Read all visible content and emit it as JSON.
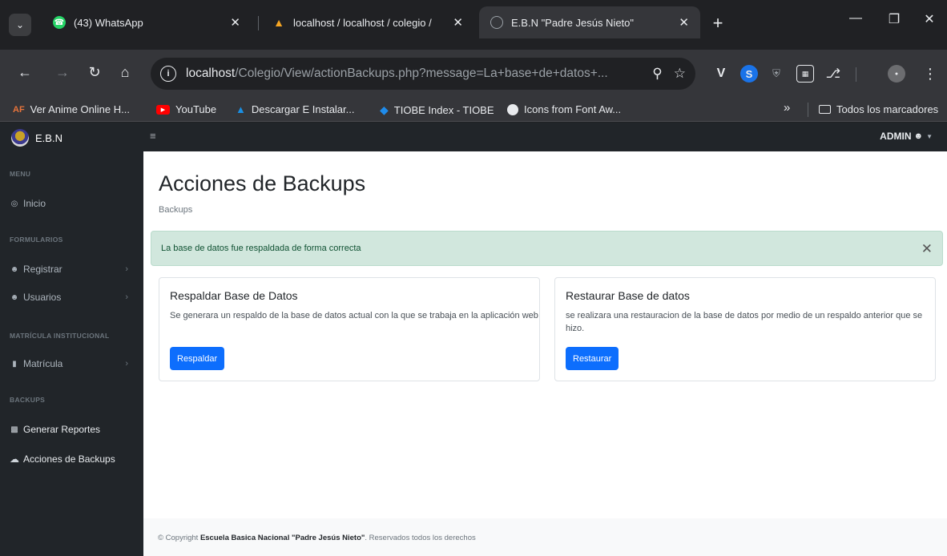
{
  "browser": {
    "tabs": [
      {
        "title": "(43) WhatsApp",
        "icon": "whatsapp-icon",
        "color": "#25d366"
      },
      {
        "title": "localhost / localhost / colegio / ",
        "icon": "phpmyadmin-icon",
        "color": "#f6a623"
      },
      {
        "title": "E.B.N \"Padre Jesús Nieto\"",
        "icon": "globe-icon",
        "color": "#9aa0a6"
      }
    ],
    "address": {
      "host": "localhost",
      "path": "/Colegio/View/actionBackups.php?message=La+base+de+datos+..."
    },
    "bookmarks": [
      {
        "label": "Ver Anime Online H...",
        "icon": "af-icon",
        "color": "#e8743b"
      },
      {
        "label": "YouTube",
        "icon": "youtube-icon",
        "color": "#ff0000"
      },
      {
        "label": "Descargar E Instalar...",
        "icon": "download-icon",
        "color": "#1a8fe3"
      },
      {
        "label": "TIOBE Index - TIOBE",
        "icon": "tiobe-icon",
        "color": "#1f8ceb"
      },
      {
        "label": "Icons from Font Aw...",
        "icon": "globe-icon",
        "color": "#e8eaed"
      }
    ],
    "bookmarks_overflow": "»",
    "all_bookmarks": "Todos los marcadores"
  },
  "app": {
    "brand": "E.B.N",
    "user": "ADMIN",
    "sidebar": {
      "sections": [
        {
          "heading": "MENU",
          "items": [
            {
              "label": "Inicio",
              "icon": "dashboard-icon",
              "chevron": false
            }
          ]
        },
        {
          "heading": "FORMULARIOS",
          "items": [
            {
              "label": "Registrar",
              "icon": "user-icon",
              "chevron": true
            },
            {
              "label": "Usuarios",
              "icon": "users-icon",
              "chevron": true
            }
          ]
        },
        {
          "heading": "MATRÍCULA INSTITUCIONAL",
          "items": [
            {
              "label": "Matrícula",
              "icon": "file-icon",
              "chevron": true
            }
          ]
        },
        {
          "heading": "BACKUPS",
          "items": [
            {
              "label": "Generar Reportes",
              "icon": "report-icon",
              "chevron": false
            },
            {
              "label": "Acciones de Backups",
              "icon": "cloud-icon",
              "chevron": false
            }
          ]
        }
      ]
    },
    "page_title": "Acciones de Backups",
    "breadcrumb": "Backups",
    "alert": "La base de datos fue respaldada de forma correcta",
    "cards": [
      {
        "title": "Respaldar Base de Datos",
        "text": "Se generara un respaldo de la base de datos actual con la que se trabaja en la aplicación web",
        "button": "Respaldar"
      },
      {
        "title": "Restaurar Base de datos",
        "text": "se realizara una restauracion de la base de datos por medio de un respaldo anterior que se hizo.",
        "button": "Restaurar"
      }
    ],
    "footer": {
      "prefix": "© Copyright ",
      "org": "Escuela Basica Nacional \"Padre Jesús Nieto\"",
      "suffix": ". Reservados todos los derechos"
    },
    "colors": {
      "primary": "#0d6efd",
      "dark": "#212529",
      "alert_bg": "#d1e7dd"
    }
  }
}
